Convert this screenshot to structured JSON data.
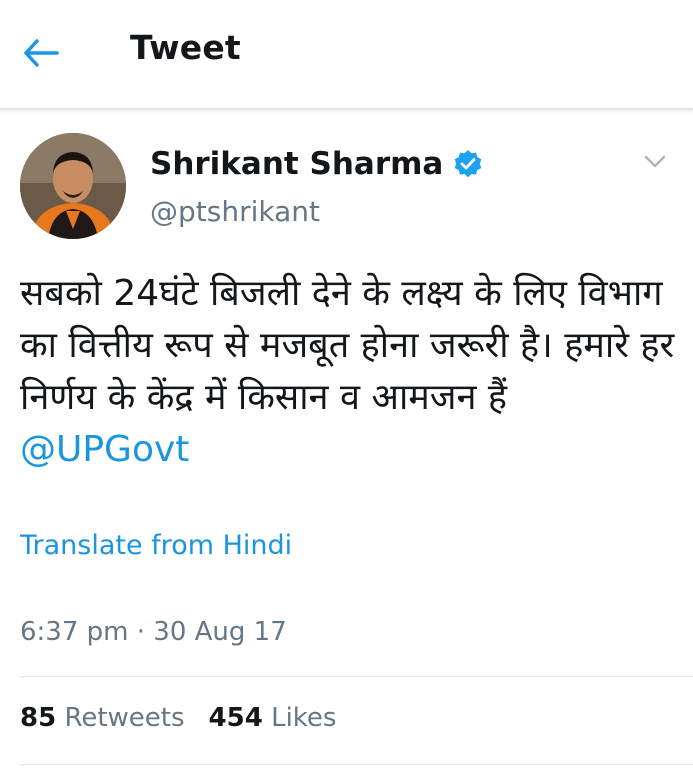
{
  "header": {
    "title": "Tweet",
    "back_icon": "back-arrow-icon"
  },
  "tweet": {
    "author_name": "Shrikant Sharma",
    "author_handle": "@ptshrikant",
    "verified": true,
    "text": "सबको 24घंटे बिजली देने के लक्ष्य के लिए विभाग का वित्तीय रूप से मजबूत होना जरूरी है। हमारे हर निर्णय के केंद्र में किसान व आमजन हैं ",
    "mention": "@UPGovt",
    "translate_label": "Translate from Hindi",
    "timestamp": "6:37 pm · 30 Aug 17",
    "retweets_count": "85",
    "retweets_label": "Retweets",
    "likes_count": "454",
    "likes_label": "Likes"
  },
  "colors": {
    "accent": "#1b95e0",
    "text": "#14171a",
    "secondary": "#657786",
    "divider": "#e1e8ed"
  }
}
